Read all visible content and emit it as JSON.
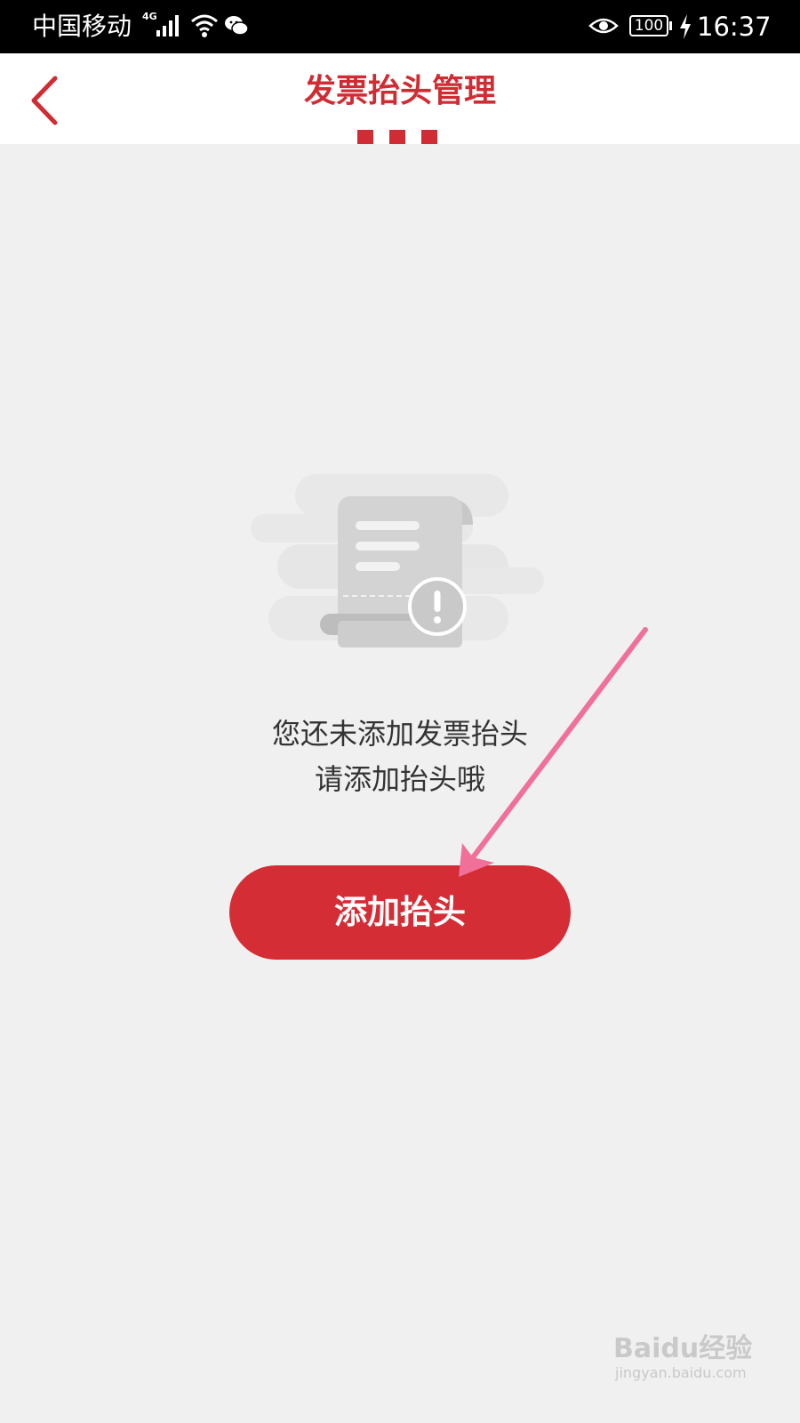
{
  "status_bar": {
    "carrier": "中国移动",
    "network_type": "4G",
    "battery_level": "100",
    "time": "16:37",
    "icons": [
      "signal-icon",
      "wifi-icon",
      "wechat-icon",
      "eye-icon",
      "battery-icon",
      "charging-icon"
    ]
  },
  "header": {
    "title": "发票抬头管理",
    "back_icon": "chevron-left-icon",
    "accent_color": "#d12c33"
  },
  "empty_state": {
    "illustration": "invoice-scroll-warning-icon",
    "line1": "您还未添加发票抬头",
    "line2": "请添加抬头哦"
  },
  "actions": {
    "add_button_label": "添加抬头",
    "button_color": "#d52d35"
  },
  "annotation": {
    "arrow_color": "#f0709a",
    "arrow_icon": "pointer-arrow-icon"
  },
  "watermark": {
    "brand": "Baidu经验",
    "url": "jingyan.baidu.com"
  },
  "colors": {
    "background": "#f0f0f0",
    "status_bar": "#000000",
    "header": "#ffffff"
  }
}
